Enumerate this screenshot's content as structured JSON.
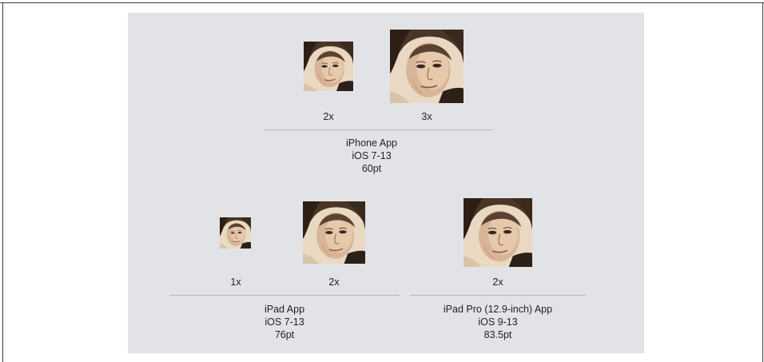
{
  "iphone": {
    "icons": [
      {
        "label": "2x",
        "icon": "portrait-icon"
      },
      {
        "label": "3x",
        "icon": "portrait-icon"
      }
    ],
    "title": "iPhone App",
    "os": "iOS 7-13",
    "size": "60pt"
  },
  "ipad": {
    "icons": [
      {
        "label": "1x",
        "icon": "portrait-icon"
      },
      {
        "label": "2x",
        "icon": "portrait-icon"
      }
    ],
    "title": "iPad App",
    "os": "iOS 7-13",
    "size": "76pt"
  },
  "ipad_pro": {
    "icons": [
      {
        "label": "2x",
        "icon": "portrait-icon"
      }
    ],
    "title": "iPad Pro (12.9-inch) App",
    "os": "iOS 9-13",
    "size": "83.5pt"
  },
  "colors": {
    "panel_background": "#e2e3e7",
    "rule": "#b6b7bb",
    "text": "#222222"
  }
}
